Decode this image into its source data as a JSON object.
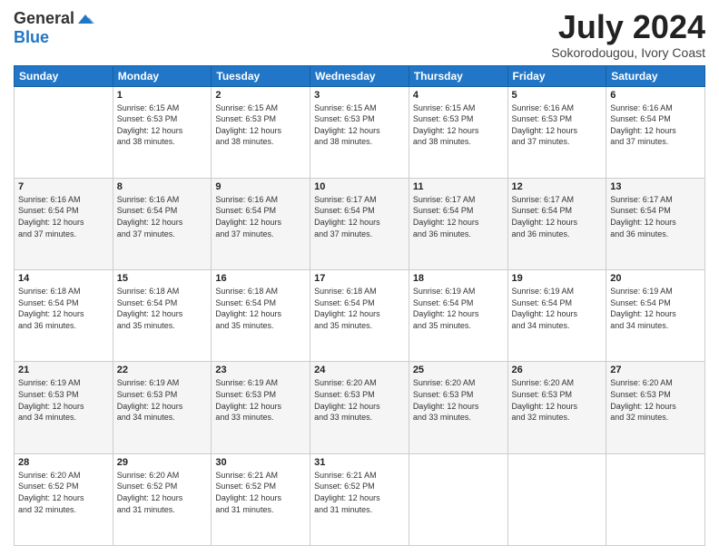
{
  "logo": {
    "general": "General",
    "blue": "Blue"
  },
  "header": {
    "month": "July 2024",
    "location": "Sokorodougou, Ivory Coast"
  },
  "weekdays": [
    "Sunday",
    "Monday",
    "Tuesday",
    "Wednesday",
    "Thursday",
    "Friday",
    "Saturday"
  ],
  "weeks": [
    [
      {
        "day": "",
        "info": ""
      },
      {
        "day": "1",
        "info": "Sunrise: 6:15 AM\nSunset: 6:53 PM\nDaylight: 12 hours\nand 38 minutes."
      },
      {
        "day": "2",
        "info": "Sunrise: 6:15 AM\nSunset: 6:53 PM\nDaylight: 12 hours\nand 38 minutes."
      },
      {
        "day": "3",
        "info": "Sunrise: 6:15 AM\nSunset: 6:53 PM\nDaylight: 12 hours\nand 38 minutes."
      },
      {
        "day": "4",
        "info": "Sunrise: 6:15 AM\nSunset: 6:53 PM\nDaylight: 12 hours\nand 38 minutes."
      },
      {
        "day": "5",
        "info": "Sunrise: 6:16 AM\nSunset: 6:53 PM\nDaylight: 12 hours\nand 37 minutes."
      },
      {
        "day": "6",
        "info": "Sunrise: 6:16 AM\nSunset: 6:54 PM\nDaylight: 12 hours\nand 37 minutes."
      }
    ],
    [
      {
        "day": "7",
        "info": "Sunrise: 6:16 AM\nSunset: 6:54 PM\nDaylight: 12 hours\nand 37 minutes."
      },
      {
        "day": "8",
        "info": "Sunrise: 6:16 AM\nSunset: 6:54 PM\nDaylight: 12 hours\nand 37 minutes."
      },
      {
        "day": "9",
        "info": "Sunrise: 6:16 AM\nSunset: 6:54 PM\nDaylight: 12 hours\nand 37 minutes."
      },
      {
        "day": "10",
        "info": "Sunrise: 6:17 AM\nSunset: 6:54 PM\nDaylight: 12 hours\nand 37 minutes."
      },
      {
        "day": "11",
        "info": "Sunrise: 6:17 AM\nSunset: 6:54 PM\nDaylight: 12 hours\nand 36 minutes."
      },
      {
        "day": "12",
        "info": "Sunrise: 6:17 AM\nSunset: 6:54 PM\nDaylight: 12 hours\nand 36 minutes."
      },
      {
        "day": "13",
        "info": "Sunrise: 6:17 AM\nSunset: 6:54 PM\nDaylight: 12 hours\nand 36 minutes."
      }
    ],
    [
      {
        "day": "14",
        "info": "Sunrise: 6:18 AM\nSunset: 6:54 PM\nDaylight: 12 hours\nand 36 minutes."
      },
      {
        "day": "15",
        "info": "Sunrise: 6:18 AM\nSunset: 6:54 PM\nDaylight: 12 hours\nand 35 minutes."
      },
      {
        "day": "16",
        "info": "Sunrise: 6:18 AM\nSunset: 6:54 PM\nDaylight: 12 hours\nand 35 minutes."
      },
      {
        "day": "17",
        "info": "Sunrise: 6:18 AM\nSunset: 6:54 PM\nDaylight: 12 hours\nand 35 minutes."
      },
      {
        "day": "18",
        "info": "Sunrise: 6:19 AM\nSunset: 6:54 PM\nDaylight: 12 hours\nand 35 minutes."
      },
      {
        "day": "19",
        "info": "Sunrise: 6:19 AM\nSunset: 6:54 PM\nDaylight: 12 hours\nand 34 minutes."
      },
      {
        "day": "20",
        "info": "Sunrise: 6:19 AM\nSunset: 6:54 PM\nDaylight: 12 hours\nand 34 minutes."
      }
    ],
    [
      {
        "day": "21",
        "info": "Sunrise: 6:19 AM\nSunset: 6:53 PM\nDaylight: 12 hours\nand 34 minutes."
      },
      {
        "day": "22",
        "info": "Sunrise: 6:19 AM\nSunset: 6:53 PM\nDaylight: 12 hours\nand 34 minutes."
      },
      {
        "day": "23",
        "info": "Sunrise: 6:19 AM\nSunset: 6:53 PM\nDaylight: 12 hours\nand 33 minutes."
      },
      {
        "day": "24",
        "info": "Sunrise: 6:20 AM\nSunset: 6:53 PM\nDaylight: 12 hours\nand 33 minutes."
      },
      {
        "day": "25",
        "info": "Sunrise: 6:20 AM\nSunset: 6:53 PM\nDaylight: 12 hours\nand 33 minutes."
      },
      {
        "day": "26",
        "info": "Sunrise: 6:20 AM\nSunset: 6:53 PM\nDaylight: 12 hours\nand 32 minutes."
      },
      {
        "day": "27",
        "info": "Sunrise: 6:20 AM\nSunset: 6:53 PM\nDaylight: 12 hours\nand 32 minutes."
      }
    ],
    [
      {
        "day": "28",
        "info": "Sunrise: 6:20 AM\nSunset: 6:52 PM\nDaylight: 12 hours\nand 32 minutes."
      },
      {
        "day": "29",
        "info": "Sunrise: 6:20 AM\nSunset: 6:52 PM\nDaylight: 12 hours\nand 31 minutes."
      },
      {
        "day": "30",
        "info": "Sunrise: 6:21 AM\nSunset: 6:52 PM\nDaylight: 12 hours\nand 31 minutes."
      },
      {
        "day": "31",
        "info": "Sunrise: 6:21 AM\nSunset: 6:52 PM\nDaylight: 12 hours\nand 31 minutes."
      },
      {
        "day": "",
        "info": ""
      },
      {
        "day": "",
        "info": ""
      },
      {
        "day": "",
        "info": ""
      }
    ]
  ]
}
